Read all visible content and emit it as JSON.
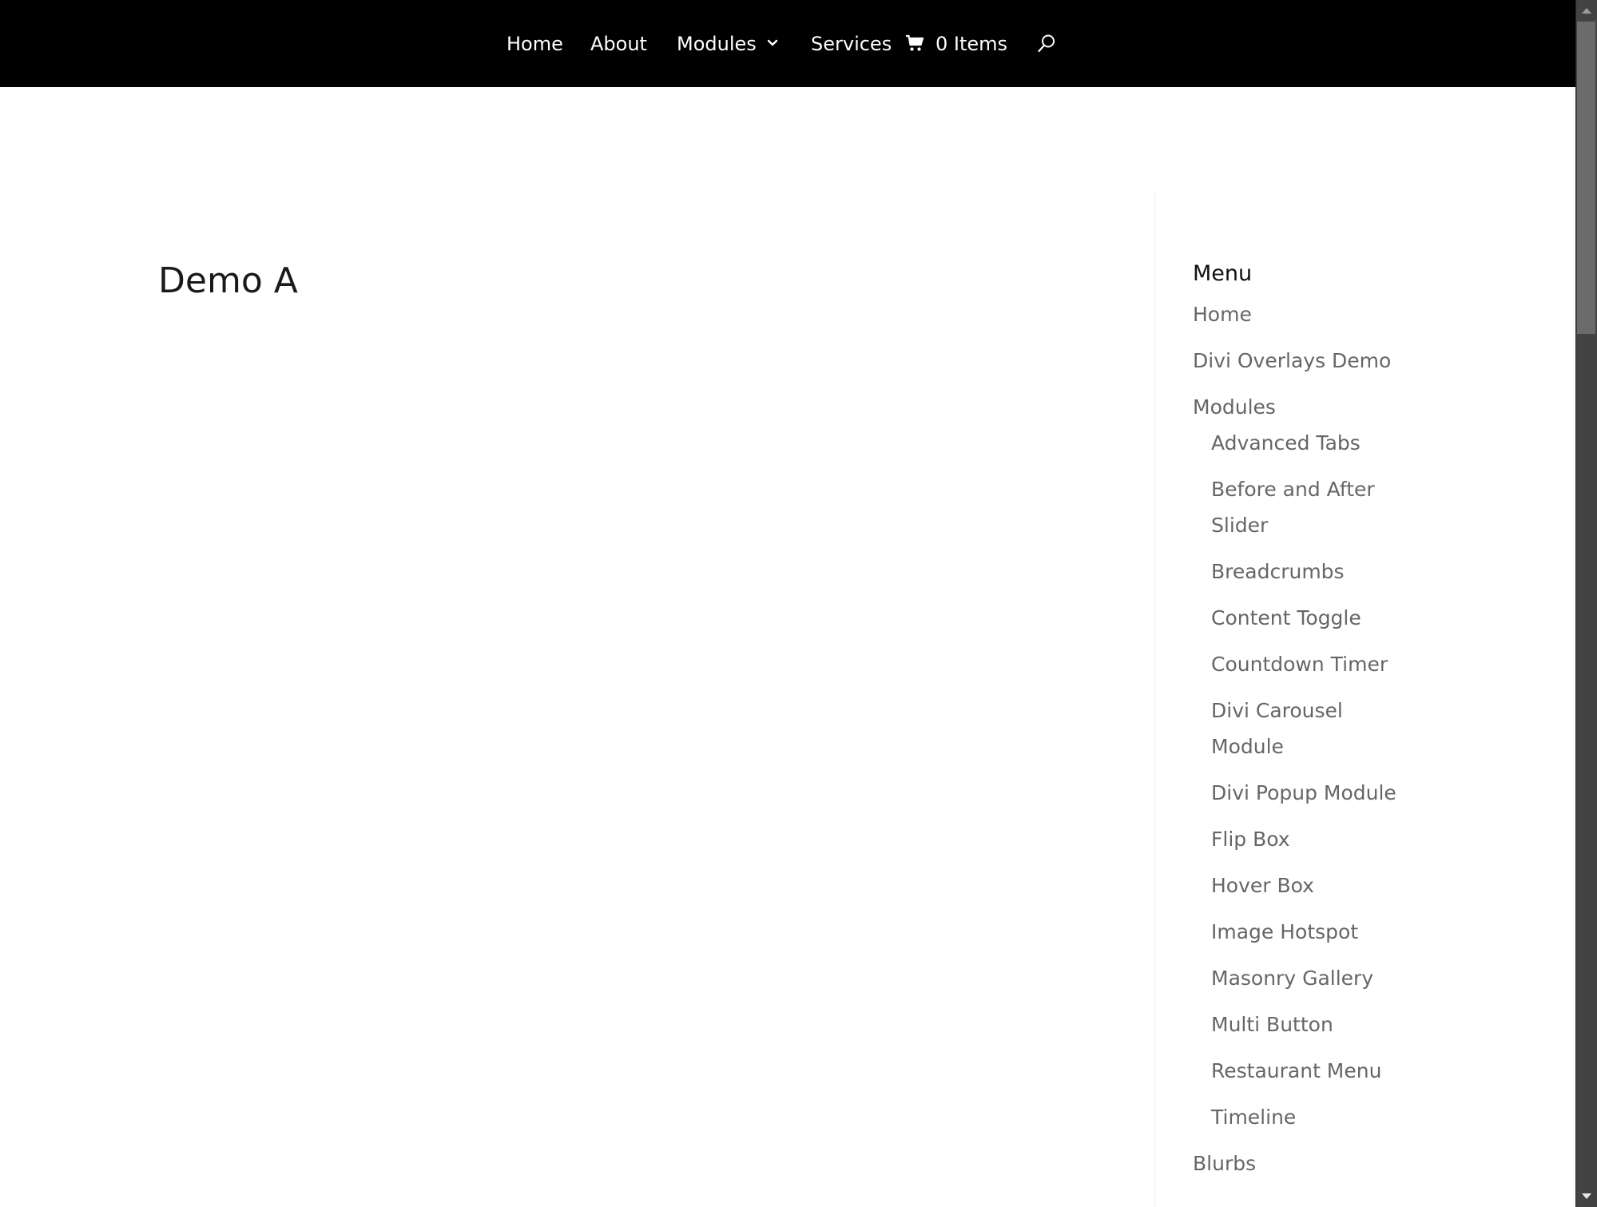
{
  "header": {
    "background_color": "#000000",
    "nav": {
      "home": "Home",
      "about": "About",
      "modules": "Modules",
      "services": "Services",
      "cart_items": "0 Items"
    },
    "icons": {
      "modules_dropdown": "chevron-down-icon",
      "cart": "cart-icon",
      "search": "search-icon"
    }
  },
  "main": {
    "page_title": "Demo A"
  },
  "sidebar": {
    "widget_title": "Menu",
    "link_color": "#666666",
    "items": [
      {
        "label": "Home"
      },
      {
        "label": "Divi Overlays Demo"
      },
      {
        "label": "Modules",
        "children": [
          {
            "label": "Advanced Tabs"
          },
          {
            "label": "Before and After Slider"
          },
          {
            "label": "Breadcrumbs"
          },
          {
            "label": "Content Toggle"
          },
          {
            "label": "Countdown Timer"
          },
          {
            "label": "Divi Carousel Module"
          },
          {
            "label": "Divi Popup Module"
          },
          {
            "label": "Flip Box"
          },
          {
            "label": "Hover Box"
          },
          {
            "label": "Image Hotspot"
          },
          {
            "label": "Masonry Gallery"
          },
          {
            "label": "Multi Button"
          },
          {
            "label": "Restaurant Menu"
          },
          {
            "label": "Timeline"
          }
        ]
      },
      {
        "label": "Blurbs"
      }
    ]
  },
  "scrollbar": {
    "scroll_position_fraction": 0.0
  }
}
